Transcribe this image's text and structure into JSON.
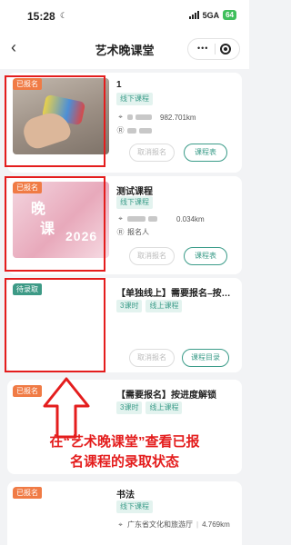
{
  "status_bar": {
    "time": "15:28",
    "network": "5GA",
    "battery": "64"
  },
  "nav": {
    "back_icon": "‹",
    "title": "艺术晚课堂",
    "menu_icon": "•••"
  },
  "cards": [
    {
      "badge": "已报名",
      "title": "1",
      "tags": [
        "线下课程"
      ],
      "distance": "982.701km",
      "cancel_label": "取消报名",
      "action_label": "课程表"
    },
    {
      "badge": "已报名",
      "title": "测试课程",
      "tags": [
        "线下课程"
      ],
      "distance": "0.034km",
      "person_label": "报名人",
      "poster_year": "2026",
      "poster_char1": "晚",
      "poster_char2": "课",
      "cancel_label": "取消报名",
      "action_label": "课程表"
    },
    {
      "badge": "待录取",
      "title": "【单独线上】需要报名–按…",
      "tags": [
        "3课时",
        "线上课程"
      ],
      "cancel_label": "取消报名",
      "action_label": "课程目录"
    },
    {
      "badge": "已报名",
      "title": "【需要报名】按进度解锁",
      "tags": [
        "3课时",
        "线上课程"
      ]
    },
    {
      "badge": "已报名",
      "title": "书法",
      "tags": [
        "线下课程"
      ],
      "location": "广东省文化和旅游厅",
      "distance": "4.769km"
    }
  ],
  "annotation": {
    "line1": "在“艺术晚课堂”查看已报",
    "line2": "名课程的录取状态"
  },
  "colors": {
    "accent": "#3b9c89",
    "badge_orange": "#f07b45",
    "badge_teal": "#3d9a86",
    "annotation_red": "#e41d1d"
  }
}
